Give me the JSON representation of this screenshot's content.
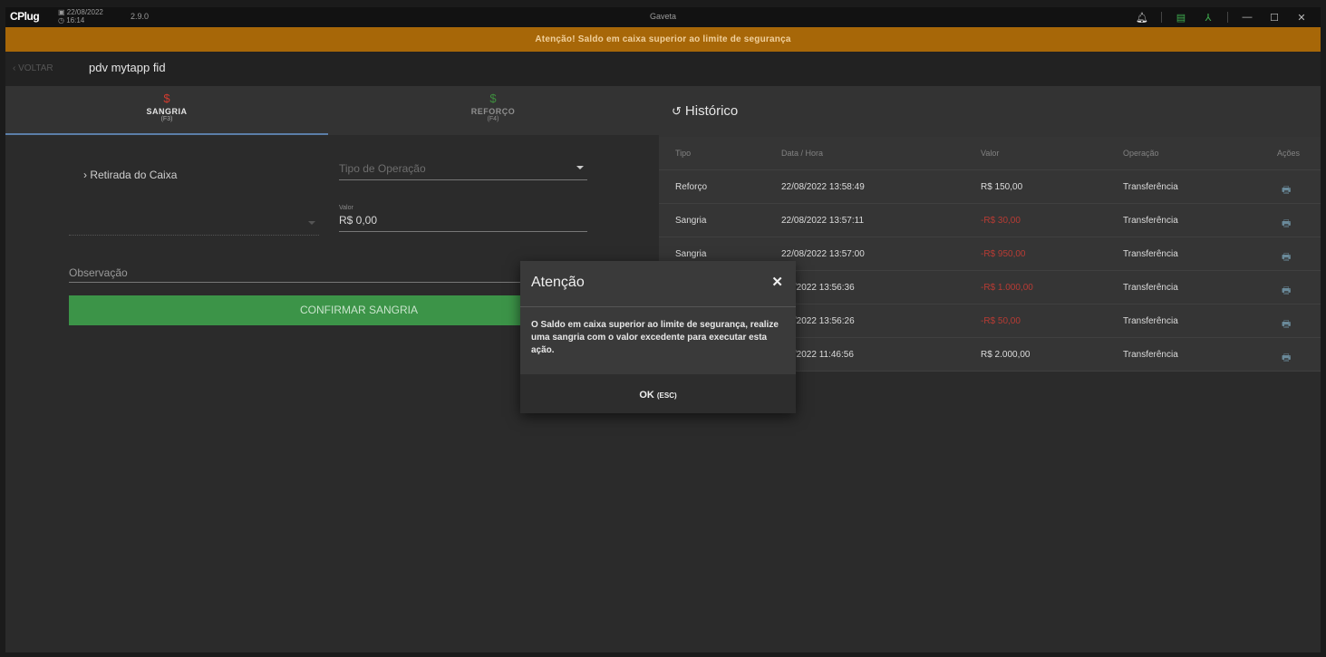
{
  "titlebar": {
    "logo_text": "CPlug",
    "date": "22/08/2022",
    "time": "16:14",
    "version": "2.9.0",
    "title": "Gaveta",
    "icons": [
      "bell-icon",
      "network-icon",
      "user-tree-icon",
      "minimize-icon",
      "maximize-icon",
      "close-icon"
    ]
  },
  "banner": {
    "text": "Atenção! Saldo em caixa superior ao limite de segurança",
    "color": "#a76708"
  },
  "nav": {
    "back_label": "VOLTAR",
    "store_name": "pdv mytapp fid"
  },
  "tabs": [
    {
      "icon": "$",
      "label": "SANGRIA",
      "key": "(F3)"
    },
    {
      "icon": "$",
      "label": "REFORÇO",
      "key": "(F4)"
    }
  ],
  "form": {
    "retirada_label": "Retirada do Caixa",
    "tipo_operacao_placeholder": "Tipo de Operação",
    "valor_label": "Valor",
    "valor_value": "R$ 0,00",
    "observacao_placeholder": "Observação",
    "confirm_label": "CONFIRMAR SANGRIA"
  },
  "history": {
    "title": "Histórico",
    "columns": [
      "Tipo",
      "Data / Hora",
      "Valor",
      "Operação",
      "Ações"
    ],
    "rows": [
      {
        "tipo": "Reforço",
        "data": "22/08/2022 13:58:49",
        "valor": "R$ 150,00",
        "negative": false,
        "operacao": "Transferência"
      },
      {
        "tipo": "Sangria",
        "data": "22/08/2022 13:57:11",
        "valor": "-R$ 30,00",
        "negative": true,
        "operacao": "Transferência"
      },
      {
        "tipo": "Sangria",
        "data": "22/08/2022 13:57:00",
        "valor": "-R$ 950,00",
        "negative": true,
        "operacao": "Transferência"
      },
      {
        "tipo": "",
        "data": "/08/2022 13:56:36",
        "valor": "-R$ 1.000,00",
        "negative": true,
        "operacao": "Transferência"
      },
      {
        "tipo": "",
        "data": "/08/2022 13:56:26",
        "valor": "-R$ 50,00",
        "negative": true,
        "operacao": "Transferência"
      },
      {
        "tipo": "",
        "data": "/02/2022 11:46:56",
        "valor": "R$ 2.000,00",
        "negative": false,
        "operacao": "Transferência"
      }
    ]
  },
  "dialog": {
    "title": "Atenção",
    "message": "O Saldo em caixa superior ao limite de segurança, realize uma sangria com o valor excedente para executar esta ação.",
    "ok_label": "OK",
    "ok_key": "(ESC)"
  }
}
